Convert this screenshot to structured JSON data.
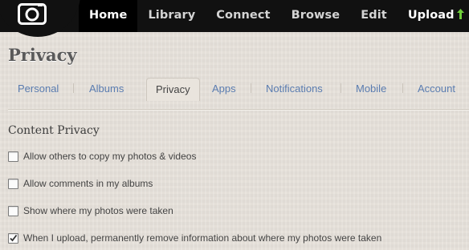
{
  "nav": {
    "items": [
      {
        "label": "Home"
      },
      {
        "label": "Library"
      },
      {
        "label": "Connect"
      },
      {
        "label": "Browse"
      },
      {
        "label": "Edit"
      },
      {
        "label": "Upload"
      }
    ],
    "active": "Home",
    "upload_icon": "up-arrow-icon",
    "upload_arrow_color": "#6fcf3a"
  },
  "logo": {
    "icon": "camera-icon"
  },
  "page": {
    "title": "Privacy"
  },
  "tabs": {
    "items": [
      {
        "label": "Personal"
      },
      {
        "label": "Albums"
      },
      {
        "label": "Privacy"
      },
      {
        "label": "Apps"
      },
      {
        "label": "Notifications"
      },
      {
        "label": "Mobile"
      },
      {
        "label": "Account"
      }
    ],
    "active": "Privacy",
    "link_color": "#5a7cb0"
  },
  "content_privacy": {
    "title": "Content Privacy",
    "options": [
      {
        "label": "Allow others to copy my photos & videos",
        "checked": false
      },
      {
        "label": "Allow comments in my albums",
        "checked": false
      },
      {
        "label": "Show where my photos were taken",
        "checked": false
      },
      {
        "label": "When I upload, permanently remove information about where my photos were taken",
        "checked": true
      }
    ]
  }
}
